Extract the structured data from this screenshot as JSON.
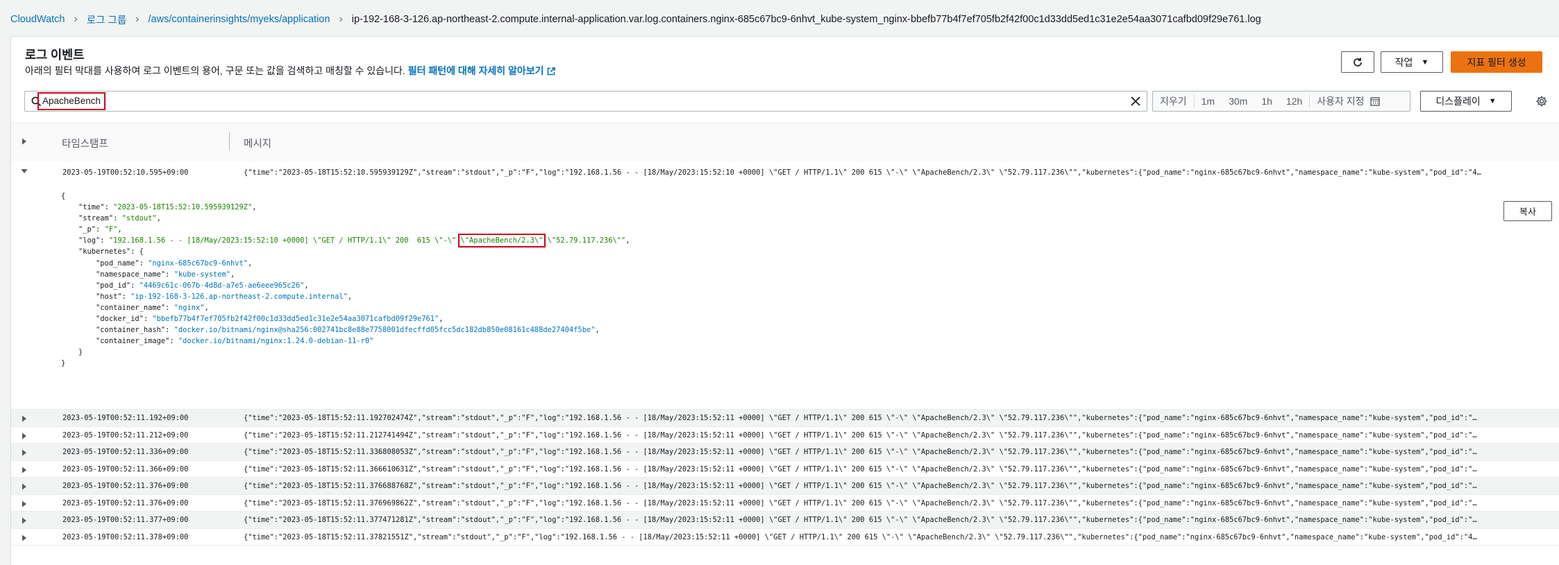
{
  "breadcrumb": {
    "items": [
      "CloudWatch",
      "로그 그룹",
      "/aws/containerinsights/myeks/application"
    ],
    "current": "ip-192-168-3-126.ap-northeast-2.compute.internal-application.var.log.containers.nginx-685c67bc9-6nhvt_kube-system_nginx-bbefb77b4f7ef705fb2f42f00c1d33dd5ed1c31e2e54aa3071cafbd09f29e761.log"
  },
  "header": {
    "title": "로그 이벤트",
    "subtitle": "아래의 필터 막대를 사용하여 로그 이벤트의 용어, 구문 또는 값을 검색하고 매칭할 수 있습니다.",
    "learn_more": "필터 패턴에 대해 자세히 알아보기",
    "actions_label": "작업",
    "create_metric_filter": "지표 필터 생성"
  },
  "search": {
    "value": "ApacheBench"
  },
  "time_range": {
    "clear": "지우기",
    "options": [
      "1m",
      "30m",
      "1h",
      "12h"
    ],
    "custom": "사용자 지정"
  },
  "display_label": "디스플레이",
  "table": {
    "col_timestamp": "타임스탬프",
    "col_message": "메시지"
  },
  "expanded_event": {
    "timestamp": "2023-05-19T00:52:10.595+09:00",
    "message": "{\"time\":\"2023-05-18T15:52:10.595939129Z\",\"stream\":\"stdout\",\"_p\":\"F\",\"log\":\"192.168.1.56 - - [18/May/2023:15:52:10 +0000] \\\"GET / HTTP/1.1\\\" 200 615 \\\"-\\\" \\\"ApacheBench/2.3\\\" \\\"52.79.117.236\\\"\",\"kubernetes\":{\"pod_name\":\"nginx-685c67bc9-6nhvt\",\"namespace_name\":\"kube-system\",\"pod_id\":\"4…",
    "copy_label": "복사",
    "json": {
      "open": "{",
      "time_key": "\"time\": ",
      "time_val": "\"2023-05-18T15:52:10.595939129Z\"",
      "stream_key": "\"stream\": ",
      "stream_val": "\"stdout\"",
      "p_key": "\"_p\": ",
      "p_val": "\"F\"",
      "log_key": "\"log\": ",
      "log_val_a": "\"192.168.1.56 - - [18/May/2023:15:52:10 +0000] \\\"GET / HTTP/1.1\\\" 200  615 \\\"-\\\" ",
      "log_val_hl": "\\\"ApacheBench/2.3\\\"",
      "log_val_b": " \\\"52.79.117.236\\\"\"",
      "k8s_key": "\"kubernetes\": {",
      "pod_name_key": "\"pod_name\": ",
      "pod_name_val": "\"nginx-685c67bc9-6nhvt\"",
      "ns_key": "\"namespace_name\": ",
      "ns_val": "\"kube-system\"",
      "pod_id_key": "\"pod_id\": ",
      "pod_id_val": "\"4469c61c-067b-4d8d-a7e5-ae6eee965c26\"",
      "host_key": "\"host\": ",
      "host_val": "\"ip-192-168-3-126.ap-northeast-2.compute.internal\"",
      "cname_key": "\"container_name\": ",
      "cname_val": "\"nginx\"",
      "docker_key": "\"docker_id\": ",
      "docker_val": "\"bbefb77b4f7ef705fb2f42f00c1d33dd5ed1c31e2e54aa3071cafbd09f29e761\"",
      "hash_key": "\"container_hash\": ",
      "hash_val": "\"docker.io/bitnami/nginx@sha256:002741bc8e88e7758001dfecffd05fcc5dc182db850e08161c488de27404f5be\"",
      "image_key": "\"container_image\": ",
      "image_val": "\"docker.io/bitnami/nginx:1.24.0-debian-11-r0\"",
      "close_inner": "}",
      "close": "}"
    }
  },
  "events": [
    {
      "ts": "2023-05-19T00:52:11.192+09:00",
      "msg": "{\"time\":\"2023-05-18T15:52:11.192702474Z\",\"stream\":\"stdout\",\"_p\":\"F\",\"log\":\"192.168.1.56 - - [18/May/2023:15:52:11 +0000] \\\"GET / HTTP/1.1\\\" 200 615 \\\"-\\\" \\\"ApacheBench/2.3\\\" \\\"52.79.117.236\\\"\",\"kubernetes\":{\"pod_name\":\"nginx-685c67bc9-6nhvt\",\"namespace_name\":\"kube-system\",\"pod_id\":\"…"
    },
    {
      "ts": "2023-05-19T00:52:11.212+09:00",
      "msg": "{\"time\":\"2023-05-18T15:52:11.212741494Z\",\"stream\":\"stdout\",\"_p\":\"F\",\"log\":\"192.168.1.56 - - [18/May/2023:15:52:11 +0000] \\\"GET / HTTP/1.1\\\" 200 615 \\\"-\\\" \\\"ApacheBench/2.3\\\" \\\"52.79.117.236\\\"\",\"kubernetes\":{\"pod_name\":\"nginx-685c67bc9-6nhvt\",\"namespace_name\":\"kube-system\",\"pod_id\":\"…"
    },
    {
      "ts": "2023-05-19T00:52:11.336+09:00",
      "msg": "{\"time\":\"2023-05-18T15:52:11.336808053Z\",\"stream\":\"stdout\",\"_p\":\"F\",\"log\":\"192.168.1.56 - - [18/May/2023:15:52:11 +0000] \\\"GET / HTTP/1.1\\\" 200 615 \\\"-\\\" \\\"ApacheBench/2.3\\\" \\\"52.79.117.236\\\"\",\"kubernetes\":{\"pod_name\":\"nginx-685c67bc9-6nhvt\",\"namespace_name\":\"kube-system\",\"pod_id\":\"…"
    },
    {
      "ts": "2023-05-19T00:52:11.366+09:00",
      "msg": "{\"time\":\"2023-05-18T15:52:11.366610631Z\",\"stream\":\"stdout\",\"_p\":\"F\",\"log\":\"192.168.1.56 - - [18/May/2023:15:52:11 +0000] \\\"GET / HTTP/1.1\\\" 200 615 \\\"-\\\" \\\"ApacheBench/2.3\\\" \\\"52.79.117.236\\\"\",\"kubernetes\":{\"pod_name\":\"nginx-685c67bc9-6nhvt\",\"namespace_name\":\"kube-system\",\"pod_id\":\"…"
    },
    {
      "ts": "2023-05-19T00:52:11.376+09:00",
      "msg": "{\"time\":\"2023-05-18T15:52:11.376688768Z\",\"stream\":\"stdout\",\"_p\":\"F\",\"log\":\"192.168.1.56 - - [18/May/2023:15:52:11 +0000] \\\"GET / HTTP/1.1\\\" 200 615 \\\"-\\\" \\\"ApacheBench/2.3\\\" \\\"52.79.117.236\\\"\",\"kubernetes\":{\"pod_name\":\"nginx-685c67bc9-6nhvt\",\"namespace_name\":\"kube-system\",\"pod_id\":\"…"
    },
    {
      "ts": "2023-05-19T00:52:11.376+09:00",
      "msg": "{\"time\":\"2023-05-18T15:52:11.376969862Z\",\"stream\":\"stdout\",\"_p\":\"F\",\"log\":\"192.168.1.56 - - [18/May/2023:15:52:11 +0000] \\\"GET / HTTP/1.1\\\" 200 615 \\\"-\\\" \\\"ApacheBench/2.3\\\" \\\"52.79.117.236\\\"\",\"kubernetes\":{\"pod_name\":\"nginx-685c67bc9-6nhvt\",\"namespace_name\":\"kube-system\",\"pod_id\":\"…"
    },
    {
      "ts": "2023-05-19T00:52:11.377+09:00",
      "msg": "{\"time\":\"2023-05-18T15:52:11.377471281Z\",\"stream\":\"stdout\",\"_p\":\"F\",\"log\":\"192.168.1.56 - - [18/May/2023:15:52:11 +0000] \\\"GET / HTTP/1.1\\\" 200 615 \\\"-\\\" \\\"ApacheBench/2.3\\\" \\\"52.79.117.236\\\"\",\"kubernetes\":{\"pod_name\":\"nginx-685c67bc9-6nhvt\",\"namespace_name\":\"kube-system\",\"pod_id\":\"…"
    },
    {
      "ts": "2023-05-19T00:52:11.378+09:00",
      "msg": "{\"time\":\"2023-05-18T15:52:11.37821551Z\",\"stream\":\"stdout\",\"_p\":\"F\",\"log\":\"192.168.1.56 - - [18/May/2023:15:52:11 +0000] \\\"GET / HTTP/1.1\\\" 200 615 \\\"-\\\" \\\"ApacheBench/2.3\\\" \\\"52.79.117.236\\\"\",\"kubernetes\":{\"pod_name\":\"nginx-685c67bc9-6nhvt\",\"namespace_name\":\"kube-system\",\"pod_id\":\"4…"
    }
  ],
  "colors": {
    "link": "#0073bb",
    "primary": "#ec7211",
    "highlight": "#d0021b",
    "json_value": "#1d8102"
  }
}
